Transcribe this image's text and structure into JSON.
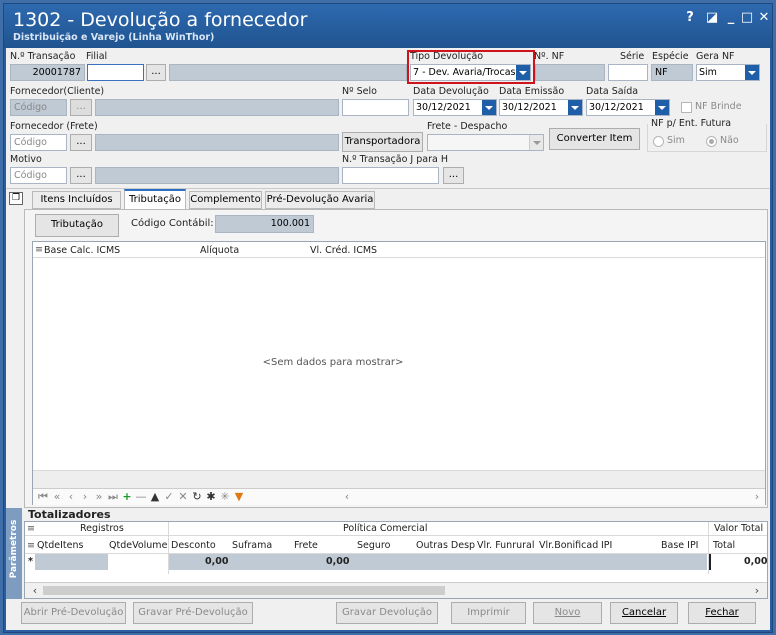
{
  "window": {
    "title": "1302 - Devolução a fornecedor",
    "subtitle": "Distribuição e Varejo (Linha WinThor)",
    "controls": {
      "help": "?",
      "restore": "◪",
      "minimize": "_",
      "maximize": "□",
      "close": "✕"
    }
  },
  "form": {
    "transacao": {
      "label": "N.º Transação",
      "value": "20001787"
    },
    "filial": {
      "label": "Filial",
      "value": "",
      "lookup": "..."
    },
    "tipo_devolucao": {
      "label": "Tipo Devolução",
      "value": "7 - Dev. Avaria/Trocas"
    },
    "num_nf": {
      "label": "Nº. NF",
      "value": ""
    },
    "serie": {
      "label": "Série",
      "value": ""
    },
    "especie": {
      "label": "Espécie",
      "value": "NF"
    },
    "gera_nf": {
      "label": "Gera NF",
      "value": "Sim"
    },
    "fornecedor_cliente": {
      "label": "Fornecedor(Cliente)",
      "placeholder": "Código",
      "lookup": "..."
    },
    "num_selo": {
      "label": "Nº Selo",
      "value": ""
    },
    "data_devolucao": {
      "label": "Data Devolução",
      "value": "30/12/2021"
    },
    "data_emissao": {
      "label": "Data Emissão",
      "value": "30/12/2021"
    },
    "data_saida": {
      "label": "Data Saída",
      "value": "30/12/2021"
    },
    "nf_brinde": {
      "label": "NF Brinde"
    },
    "fornecedor_frete": {
      "label": "Fornecedor (Frete)",
      "placeholder": "Código",
      "lookup": "..."
    },
    "transportadora": {
      "label": "Transportadora"
    },
    "frete_despacho": {
      "label": "Frete - Despacho",
      "value": ""
    },
    "converter_item": {
      "label": "Converter Item"
    },
    "nf_ent_futura": {
      "label": "NF p/ Ent. Futura",
      "sim": "Sim",
      "nao": "Não"
    },
    "motivo": {
      "label": "Motivo",
      "placeholder": "Código",
      "lookup": "..."
    },
    "transacao_para": {
      "label": "N.º Transação J para H",
      "value": "",
      "lookup": "..."
    }
  },
  "tabs": [
    {
      "label": "Itens Incluídos"
    },
    {
      "label": "Tributação"
    },
    {
      "label": "Complemento"
    },
    {
      "label": "Pré-Devolução Avaria"
    }
  ],
  "tributacao": {
    "button": "Tributação",
    "codigo_contabil_label": "Código Contábil:",
    "codigo_contabil_value": "100.001",
    "columns": [
      "Base Calc. ICMS",
      "Alíquota",
      "Vl. Créd. ICMS"
    ],
    "empty": "<Sem dados para mostrar>"
  },
  "totalizadores": {
    "title": "Totalizadores",
    "side_label": "Parâmetros",
    "band_registros": "Registros",
    "band_politica": "Política Comercial",
    "band_valor_total": "Valor Total",
    "columns": [
      "QtdeItens",
      "QtdeVolume",
      "Desconto",
      "Suframa",
      "Frete",
      "Seguro",
      "Outras Desp",
      "Vlr. Funrural",
      "Vlr.Bonificad",
      "IPI",
      "Base IPI",
      "Total"
    ],
    "row_marker": "*",
    "values": {
      "desconto": "0,00",
      "frete": "0,00",
      "total": "0,00"
    }
  },
  "footer": {
    "abrir": "Abrir Pré-Devolução",
    "gravar_pre": "Gravar Pré-Devolução",
    "gravar_dev": "Gravar Devolução",
    "imprimir": "Imprimir",
    "novo": "Novo",
    "cancelar": "Cancelar",
    "fechar": "Fechar"
  },
  "colors": {
    "title_bg": "#2a5d9e",
    "dropdown_btn": "#1f5ea8",
    "highlight_box": "#d0121a"
  }
}
